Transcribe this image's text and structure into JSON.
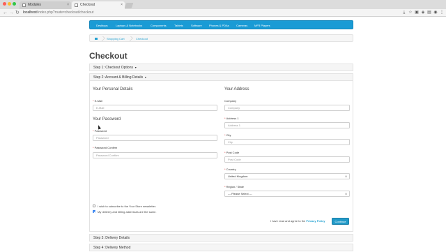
{
  "browser": {
    "tabs": [
      {
        "title": "Modules",
        "active": false
      },
      {
        "title": "Checkout",
        "active": true
      }
    ],
    "url_host": "localhost",
    "url_path": "/index.php?route=checkout/checkout",
    "traffic_colors": [
      "#fc5f57",
      "#fdbc2e",
      "#33c748"
    ]
  },
  "nav": {
    "items": [
      "Desktops",
      "Laptops & Notebooks",
      "Components",
      "Tablets",
      "Software",
      "Phones & PDAs",
      "Cameras",
      "MP3 Players"
    ],
    "color": "#1a9bd5"
  },
  "breadcrumb": [
    "Shopping Cart",
    "Checkout"
  ],
  "page_title": "Checkout",
  "steps": {
    "step1": "Step 1: Checkout Options",
    "step2": "Step 2: Account & Billing Details",
    "step3": "Step 3: Delivery Details",
    "step4": "Step 4: Delivery Method"
  },
  "personal": {
    "title": "Your Personal Details",
    "email_label": "E-Mail",
    "email_placeholder": "E-Mail"
  },
  "password": {
    "title": "Your Password",
    "password_label": "Password",
    "password_placeholder": "Password",
    "confirm_label": "Password Confirm",
    "confirm_placeholder": "Password Confirm"
  },
  "address": {
    "title": "Your Address",
    "company_label": "Company",
    "company_placeholder": "Company",
    "address1_label": "Address 1",
    "address1_placeholder": "Address 1",
    "city_label": "City",
    "city_placeholder": "City",
    "postcode_label": "Post Code",
    "postcode_placeholder": "Post Code",
    "country_label": "Country",
    "country_value": "United Kingdom",
    "region_label": "Region / State",
    "region_value": " --- Please Select --- "
  },
  "checkboxes": {
    "newsletter": "I wish to subscribe to the Your Store newsletter.",
    "newsletter_checked": false,
    "same_address": "My delivery and billing addresses are the same.",
    "same_address_checked": true
  },
  "agree": {
    "text": "I have read and agree to the",
    "link": "Privacy Policy"
  },
  "continue_label": "Continue"
}
